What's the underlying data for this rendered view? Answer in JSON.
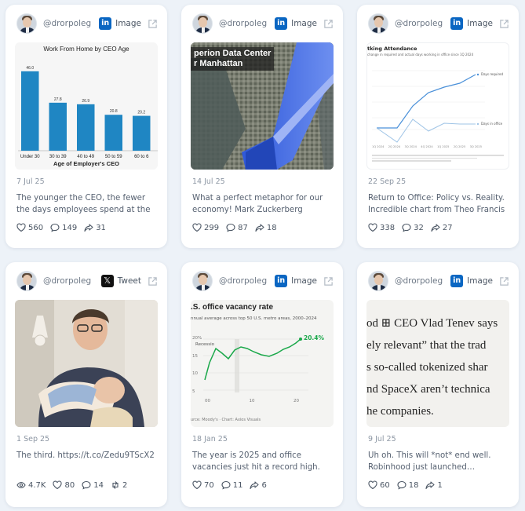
{
  "cards": [
    {
      "handle": "@drorpoleg",
      "source": "Image",
      "source_icon": "linkedin-icon",
      "date": "7 Jul 25",
      "text": "The younger the CEO, the fewer the days employees spend at the office…",
      "likes": "560",
      "comments": "149",
      "shares": "31",
      "chart": {
        "title": "Work From Home by CEO Age",
        "xlabel": "Age of Employer's CEO",
        "categories": [
          "Under 30",
          "30 to 39",
          "40 to 49",
          "50 to 59",
          "60 to 6"
        ],
        "labels": [
          "46.0",
          "27.8",
          "26.9",
          "20.8",
          "20.2"
        ],
        "values": [
          46.0,
          27.8,
          26.9,
          20.8,
          20.2
        ],
        "color": "#1f86c3"
      }
    },
    {
      "handle": "@drorpoleg",
      "source": "Image",
      "source_icon": "linkedin-icon",
      "date": "14 Jul 25",
      "text": "What a perfect metaphor for our economy! Mark Zuckerberg shared a…",
      "likes": "299",
      "comments": "87",
      "shares": "18",
      "media_caption_1": "perion Data Center",
      "media_caption_2": "r Manhattan"
    },
    {
      "handle": "@drorpoleg",
      "source": "Image",
      "source_icon": "linkedin-icon",
      "date": "22 Sep 25",
      "text": "Return to Office: Policy vs. Reality. Incredible chart from Theo Francis /…",
      "likes": "338",
      "comments": "32",
      "shares": "27",
      "chart": {
        "title": "tking Attendance",
        "subtitle": "change in required and actual days working in office since 1Q 2024",
        "legend": [
          "Days required",
          "Days in office"
        ],
        "x_labels": [
          "1Q 2024",
          "2Q 2024",
          "3Q 2024",
          "4Q 2024",
          "1Q 2025",
          "2Q 2025",
          "3Q 2025"
        ],
        "colors": [
          "#4a90d9",
          "#9fc4e6"
        ]
      }
    },
    {
      "handle": "@drorpoleg",
      "source": "Tweet",
      "source_icon": "x-icon",
      "date": "1 Sep 25",
      "text": "The third. https://t.co/Zedu9TScX2",
      "views": "4.7K",
      "likes": "80",
      "comments": "14",
      "retweets": "2"
    },
    {
      "handle": "@drorpoleg",
      "source": "Image",
      "source_icon": "linkedin-icon",
      "date": "18 Jan 25",
      "text": "The year is 2025 and office vacancies just hit a record high. Bosses can talk…",
      "likes": "70",
      "comments": "11",
      "shares": "6",
      "chart": {
        "title": ".S. office vacancy rate",
        "subtitle": "nnual average across top 50 U.S. metro areas, 2000–2024",
        "end_label": "20.4%",
        "recession_label": "Recessio",
        "y_ticks": [
          "20%",
          "15",
          "10",
          "5"
        ],
        "x_ticks": [
          "00",
          "10",
          "20"
        ],
        "source": "urce: Moody's · Chart: Axios Visuals",
        "color": "#1aa84a"
      }
    },
    {
      "handle": "@drorpoleg",
      "source": "Image",
      "source_icon": "linkedin-icon",
      "date": "9 Jul 25",
      "text": "Uh oh. This will *not* end well. Robinhood just launched… gamified…",
      "likes": "60",
      "comments": "18",
      "shares": "1",
      "quote_lines": [
        "od ⊞ CEO Vlad Tenev says",
        "ely relevant” that the trad",
        "s so-called tokenized shar",
        "nd SpaceX aren’t technica",
        "he companies."
      ]
    }
  ]
}
